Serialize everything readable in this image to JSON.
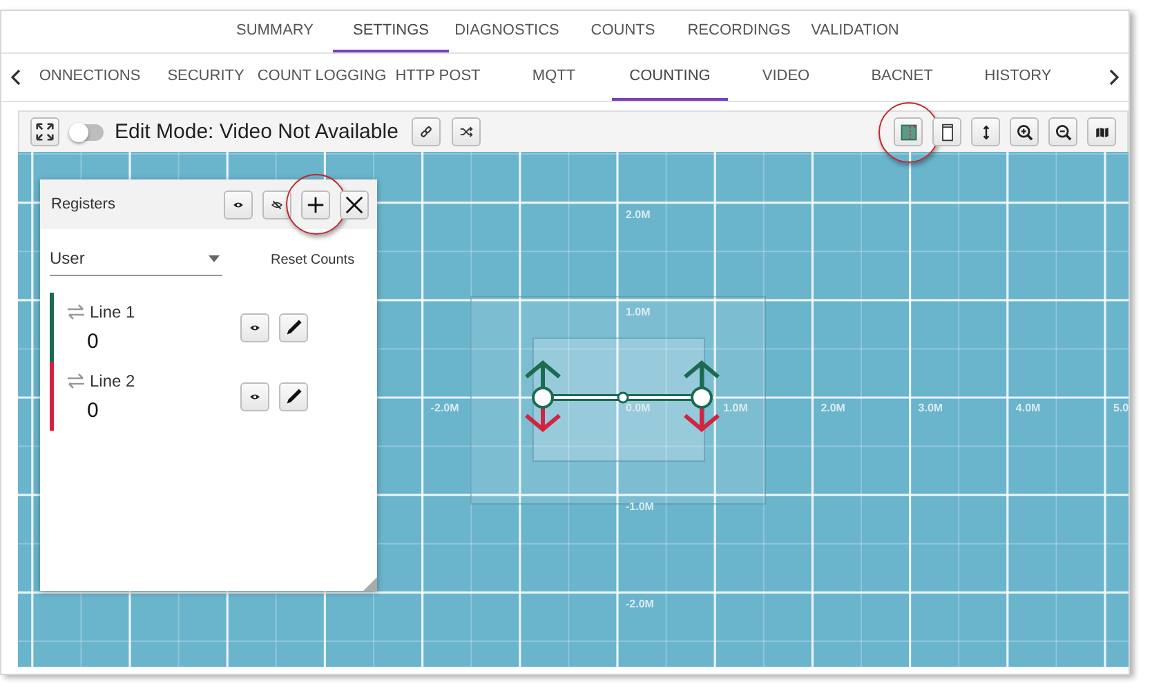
{
  "main_tabs": [
    {
      "label": "SUMMARY",
      "selected": false
    },
    {
      "label": "SETTINGS",
      "selected": true
    },
    {
      "label": "DIAGNOSTICS",
      "selected": false
    },
    {
      "label": "COUNTS",
      "selected": false
    },
    {
      "label": "RECORDINGS",
      "selected": false
    },
    {
      "label": "VALIDATION",
      "selected": false
    }
  ],
  "sub_tabs": [
    {
      "label": "ONNECTIONS",
      "selected": false
    },
    {
      "label": "SECURITY",
      "selected": false
    },
    {
      "label": "COUNT LOGGING",
      "selected": false
    },
    {
      "label": "HTTP POST",
      "selected": false
    },
    {
      "label": "MQTT",
      "selected": false
    },
    {
      "label": "COUNTING",
      "selected": true
    },
    {
      "label": "VIDEO",
      "selected": false
    },
    {
      "label": "BACNET",
      "selected": false
    },
    {
      "label": "HISTORY",
      "selected": false
    }
  ],
  "toolbar": {
    "edit_mode": {
      "label": "Edit Mode: Video Not Available",
      "on": false
    },
    "left_buttons": [
      {
        "kind": "expand",
        "highlighted": false
      },
      {
        "kind": "link",
        "highlighted": false
      },
      {
        "kind": "shuffle",
        "highlighted": false
      }
    ],
    "right_buttons": [
      {
        "kind": "area",
        "highlighted": true
      },
      {
        "kind": "page",
        "highlighted": false
      },
      {
        "kind": "updown",
        "highlighted": false
      },
      {
        "kind": "zoom-in",
        "highlighted": false
      },
      {
        "kind": "zoom-out",
        "highlighted": false
      },
      {
        "kind": "map",
        "highlighted": false
      }
    ]
  },
  "canvas": {
    "x_labels": [
      "-2.0M",
      "0.0M",
      "1.0M",
      "2.0M",
      "3.0M",
      "4.0M",
      "5.0"
    ],
    "y_labels": [
      "2.0M",
      "1.0M",
      "-1.0M",
      "-2.0M"
    ]
  },
  "registers": {
    "title": "Registers",
    "header_buttons": [
      {
        "kind": "eye",
        "highlighted": false
      },
      {
        "kind": "eye-off",
        "highlighted": false
      },
      {
        "kind": "plus",
        "highlighted": true
      },
      {
        "kind": "close",
        "highlighted": false
      }
    ],
    "filter": {
      "value": "User"
    },
    "reset_label": "Reset Counts",
    "lines": [
      {
        "name": "Line 1",
        "count": "0",
        "color": "#1b6b50"
      },
      {
        "name": "Line 2",
        "count": "0",
        "color": "#d3233f"
      }
    ]
  }
}
